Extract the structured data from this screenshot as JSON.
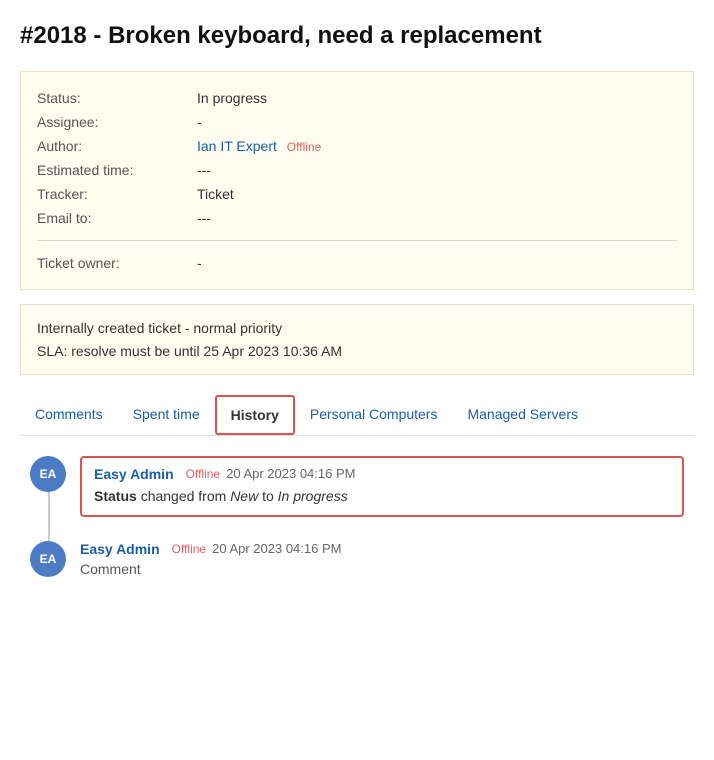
{
  "ticket": {
    "title": "#2018 - Broken keyboard, need a replacement",
    "fields": {
      "status_label": "Status:",
      "status_value": "In progress",
      "assignee_label": "Assignee:",
      "assignee_value": "-",
      "author_label": "Author:",
      "author_name": "Ian IT Expert",
      "author_status": "Offline",
      "estimated_label": "Estimated time:",
      "estimated_value": "---",
      "tracker_label": "Tracker:",
      "tracker_value": "Ticket",
      "email_label": "Email to:",
      "email_value": "---"
    },
    "owner": {
      "label": "Ticket owner:",
      "value": "-"
    },
    "notes": {
      "line1": "Internally created ticket - normal priority",
      "line2": "SLA: resolve must be until 25 Apr 2023 10:36 AM"
    }
  },
  "tabs": [
    {
      "id": "comments",
      "label": "Comments",
      "active": false
    },
    {
      "id": "spent-time",
      "label": "Spent time",
      "active": false
    },
    {
      "id": "history",
      "label": "History",
      "active": true
    },
    {
      "id": "personal-computers",
      "label": "Personal Computers",
      "active": false
    },
    {
      "id": "managed-servers",
      "label": "Managed Servers",
      "active": false
    }
  ],
  "history": {
    "entries": [
      {
        "id": "entry1",
        "avatar_initials": "EA",
        "author": "Easy Admin",
        "author_status": "Offline",
        "timestamp": "20 Apr 2023 04:16 PM",
        "highlighted": true,
        "changes": [
          {
            "field": "Status",
            "from": "New",
            "to": "In progress",
            "text_changed": "changed from",
            "text_to": "to"
          }
        ]
      },
      {
        "id": "entry2",
        "avatar_initials": "EA",
        "author": "Easy Admin",
        "author_status": "Offline",
        "timestamp": "20 Apr 2023 04:16 PM",
        "highlighted": false,
        "comment": "Comment"
      }
    ]
  }
}
